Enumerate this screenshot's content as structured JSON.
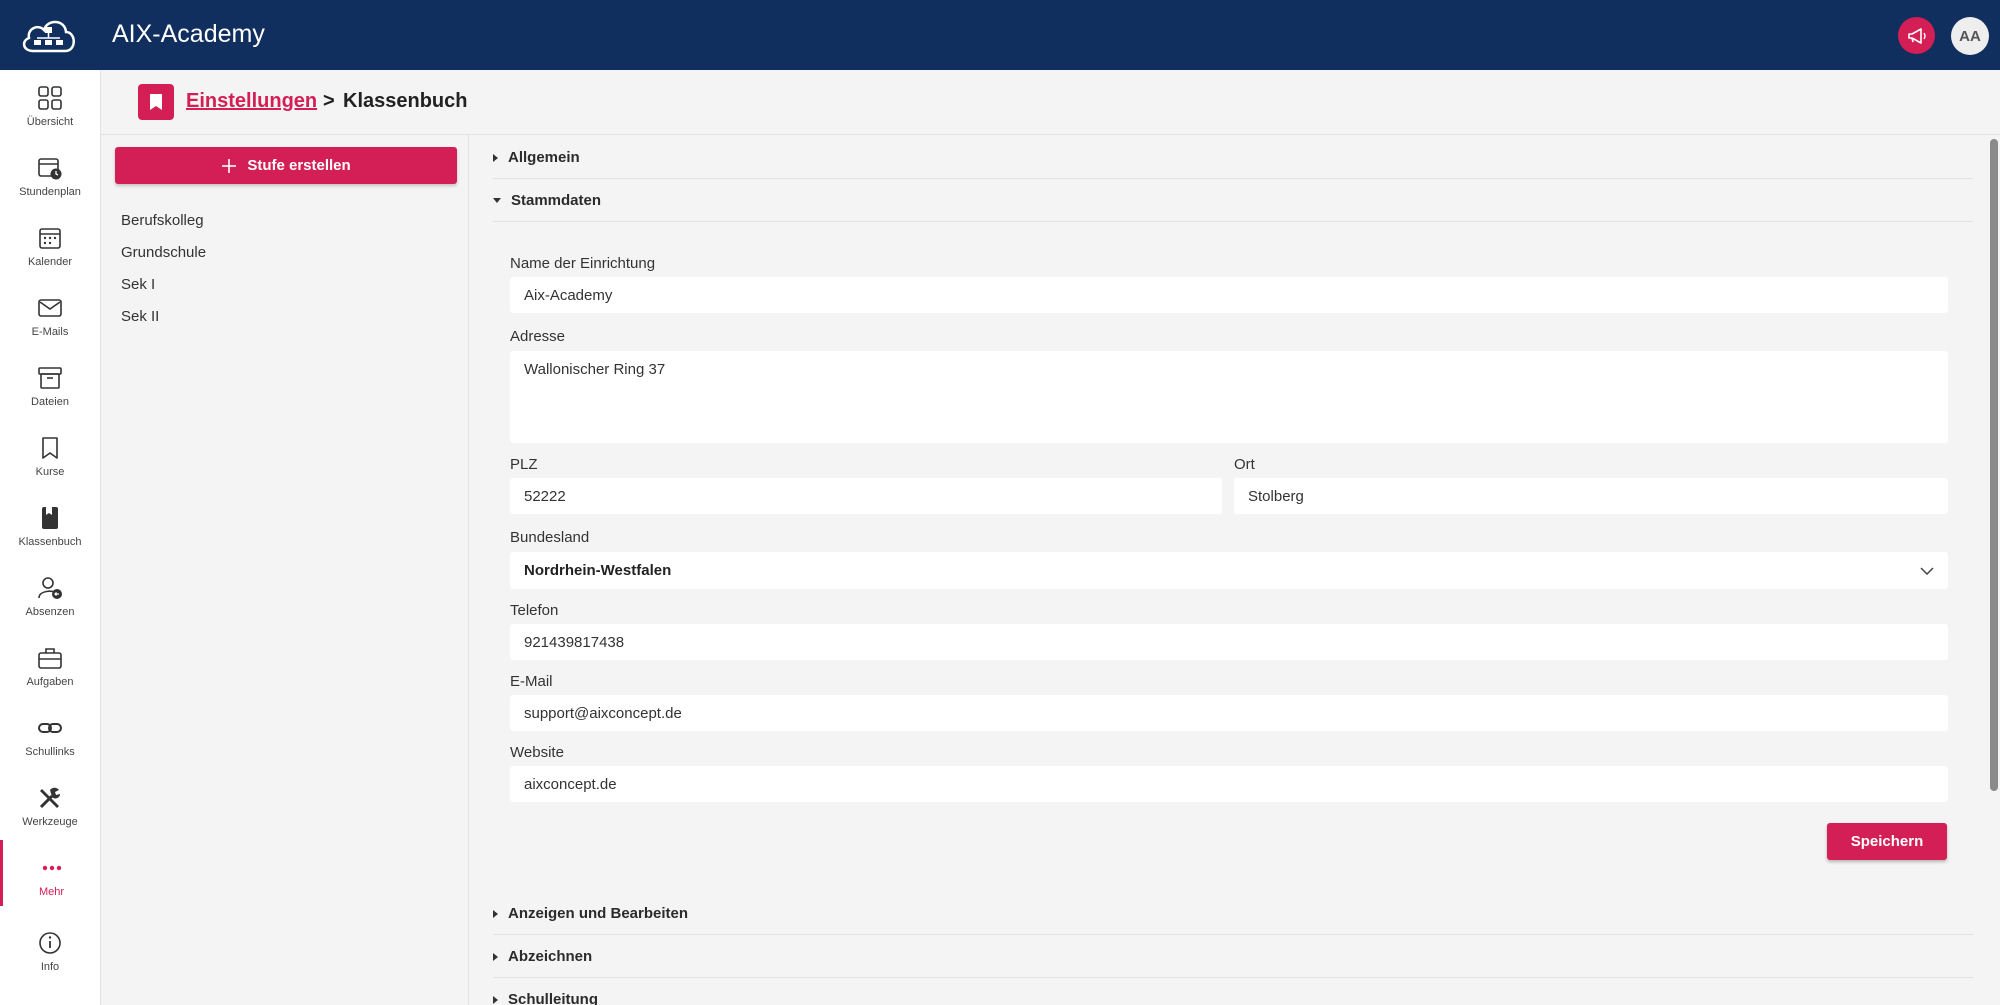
{
  "app": {
    "title": "AIX-Academy",
    "avatar_initials": "AA"
  },
  "nav": [
    {
      "label": "Übersicht",
      "icon": "grid-icon"
    },
    {
      "label": "Stundenplan",
      "icon": "schedule-icon"
    },
    {
      "label": "Kalender",
      "icon": "calendar-icon"
    },
    {
      "label": "E-Mails",
      "icon": "mail-icon"
    },
    {
      "label": "Dateien",
      "icon": "archive-icon"
    },
    {
      "label": "Kurse",
      "icon": "bookmark-icon"
    },
    {
      "label": "Klassenbuch",
      "icon": "book-icon"
    },
    {
      "label": "Absenzen",
      "icon": "user-absence-icon"
    },
    {
      "label": "Aufgaben",
      "icon": "briefcase-icon"
    },
    {
      "label": "Schullinks",
      "icon": "link-icon"
    },
    {
      "label": "Werkzeuge",
      "icon": "tools-icon"
    },
    {
      "label": "Mehr",
      "icon": "more-icon"
    },
    {
      "label": "Info",
      "icon": "info-icon"
    }
  ],
  "breadcrumb": {
    "parent": "Einstellungen",
    "separator": ">",
    "current": "Klassenbuch"
  },
  "levels": {
    "create_label": "Stufe erstellen",
    "items": [
      "Berufskolleg",
      "Grundschule",
      "Sek I",
      "Sek II"
    ]
  },
  "sections": {
    "general": "Allgemein",
    "master_data": "Stammdaten",
    "display_edit": "Anzeigen und Bearbeiten",
    "sign": "Abzeichnen",
    "school_management": "Schulleitung"
  },
  "form": {
    "name_label": "Name der Einrichtung",
    "name_value": "Aix-Academy",
    "address_label": "Adresse",
    "address_value": "Wallonischer Ring 37",
    "zip_label": "PLZ",
    "zip_value": "52222",
    "city_label": "Ort",
    "city_value": "Stolberg",
    "state_label": "Bundesland",
    "state_value": "Nordrhein-Westfalen",
    "phone_label": "Telefon",
    "phone_value": "921439817438",
    "email_label": "E-Mail",
    "email_value": "support@aixconcept.de",
    "website_label": "Website",
    "website_value": "aixconcept.de",
    "save_label": "Speichern"
  },
  "colors": {
    "topbar": "#102f5e",
    "accent": "#d31f55"
  }
}
